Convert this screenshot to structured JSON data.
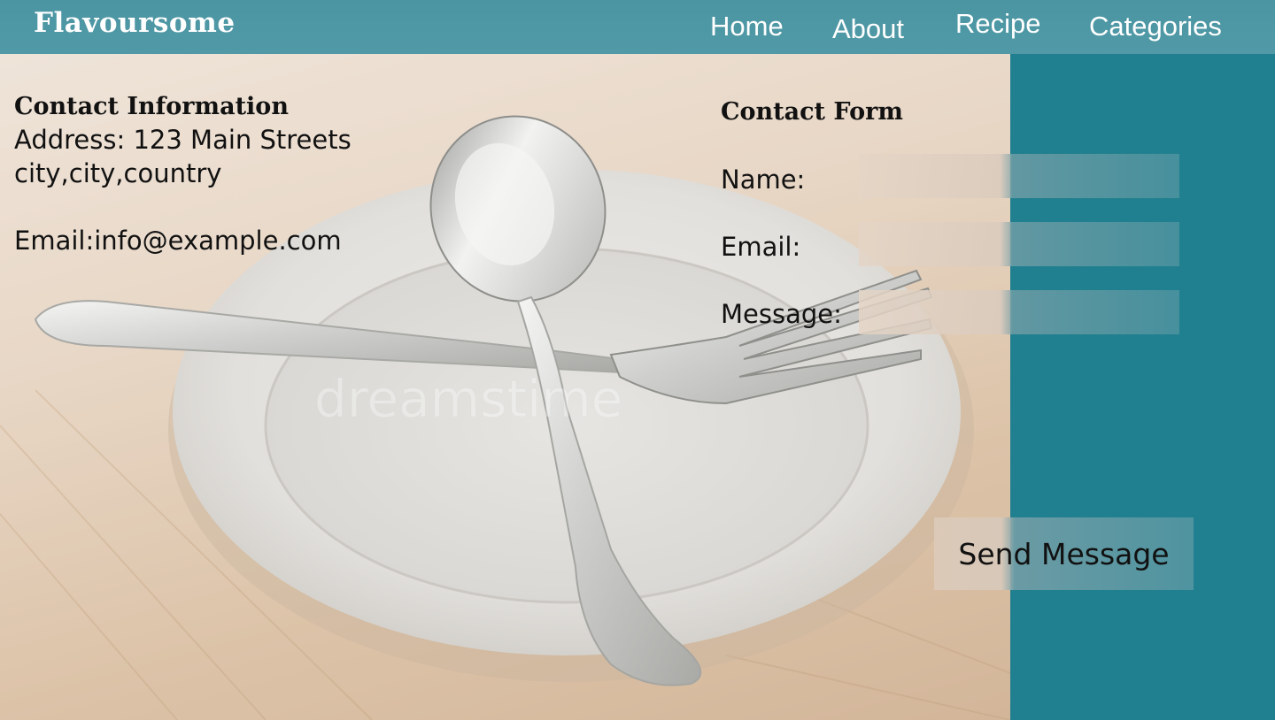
{
  "brand": {
    "name": "Flavoursome"
  },
  "nav": {
    "items": [
      {
        "label": "Home"
      },
      {
        "label": "About"
      },
      {
        "label": "Recipe"
      },
      {
        "label": "Categories"
      }
    ]
  },
  "hero": {
    "watermark": "dreamstime",
    "image_subject": "empty white plate with crossed spoon and fork on wooden table"
  },
  "contact_info": {
    "title": "Contact Information",
    "address_line1": "Address: 123 Main Streets",
    "address_line2": "city,city,country",
    "email": "Email:info@example.com"
  },
  "contact_form": {
    "title": "Contact Form",
    "name_label": "Name:",
    "email_label": "Email:",
    "message_label": "Message:",
    "name_value": "",
    "email_value": "",
    "message_value": "",
    "submit_label": "Send Message"
  },
  "colors": {
    "nav_bg": "#4f98a5",
    "sidebar_bg": "#21808f",
    "text": "#111111",
    "nav_text": "#ffffff"
  }
}
